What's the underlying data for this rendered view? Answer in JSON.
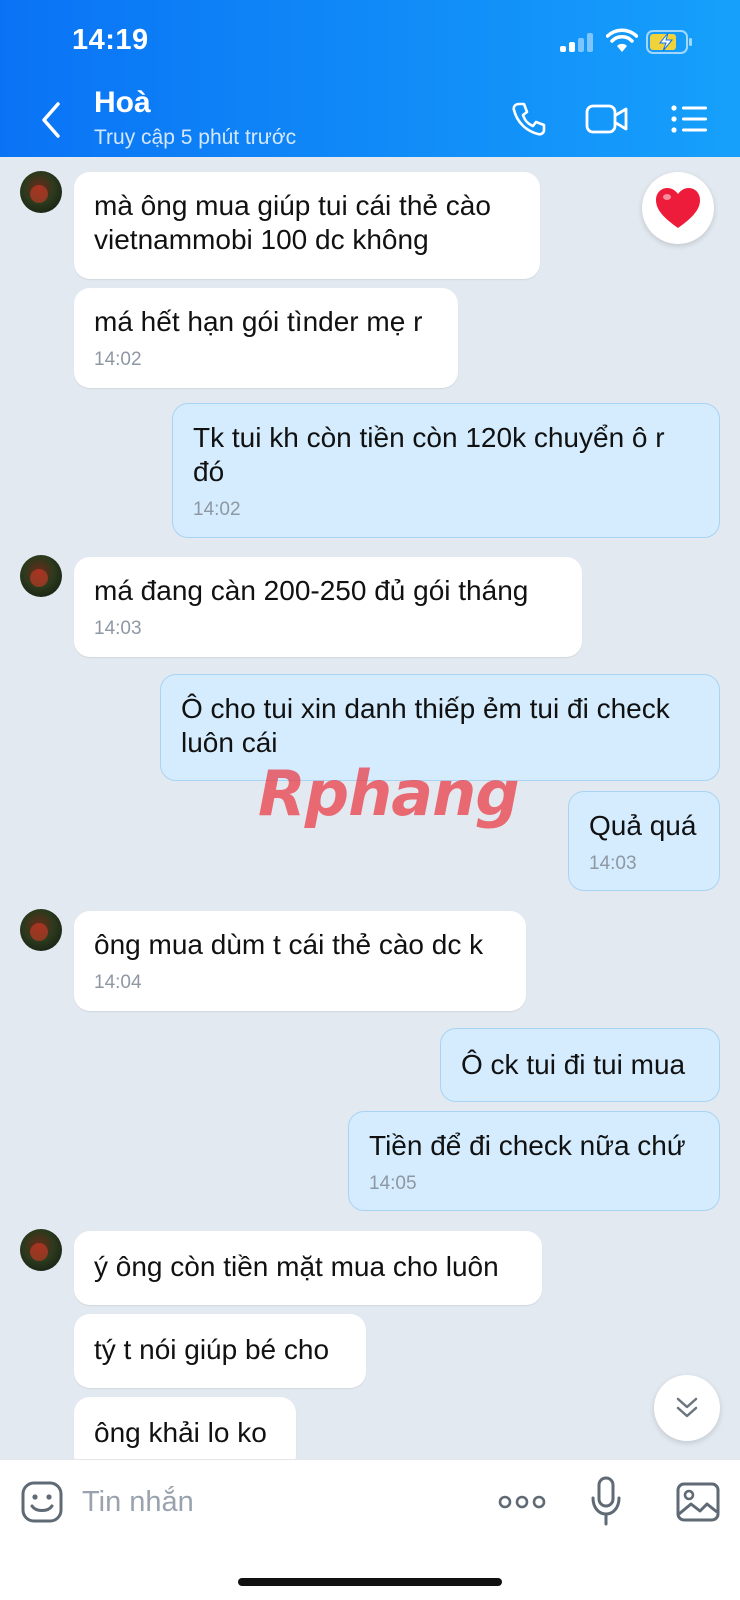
{
  "status_bar": {
    "time": "14:19"
  },
  "header": {
    "contact_name": "Hoà",
    "contact_status": "Truy cập 5 phút trước",
    "icons": [
      "back-arrow-icon",
      "phone-icon",
      "video-call-icon",
      "menu-list-icon"
    ],
    "accent_color": "#0a73f5"
  },
  "messages": [
    {
      "dir": "in",
      "text": "mà ông mua giúp tui cái thẻ cào vietnammobi 100 dc không",
      "time": "",
      "reaction": "heart"
    },
    {
      "dir": "in",
      "text": "má hết hạn gói tìnder mẹ r",
      "time": "14:02"
    },
    {
      "dir": "out",
      "text": "Tk tui kh còn tiền còn 120k chuyển ô r đó",
      "time": "14:02"
    },
    {
      "dir": "in",
      "text": "má đang càn 200-250 đủ gói tháng",
      "time": "14:03"
    },
    {
      "dir": "out",
      "text": "Ô cho tui xin danh thiếp ẻm tui đi check luôn cái",
      "time": ""
    },
    {
      "dir": "out",
      "text": "Quả quá",
      "time": "14:03"
    },
    {
      "dir": "in",
      "text": "ông mua dùm t cái thẻ cào dc k",
      "time": "14:04"
    },
    {
      "dir": "out",
      "text": "Ô ck tui đi tui mua",
      "time": ""
    },
    {
      "dir": "out",
      "text": "Tiền để đi check nữa chứ",
      "time": "14:05"
    },
    {
      "dir": "in",
      "text": "ý ông còn tiền mặt mua cho luôn",
      "time": ""
    },
    {
      "dir": "in",
      "text": "tý t nói giúp bé cho",
      "time": ""
    },
    {
      "dir": "in",
      "text": "ông khải lo ko",
      "time": ""
    }
  ],
  "watermark": {
    "text": "Rphang"
  },
  "composer": {
    "placeholder": "Tin nhắn"
  }
}
